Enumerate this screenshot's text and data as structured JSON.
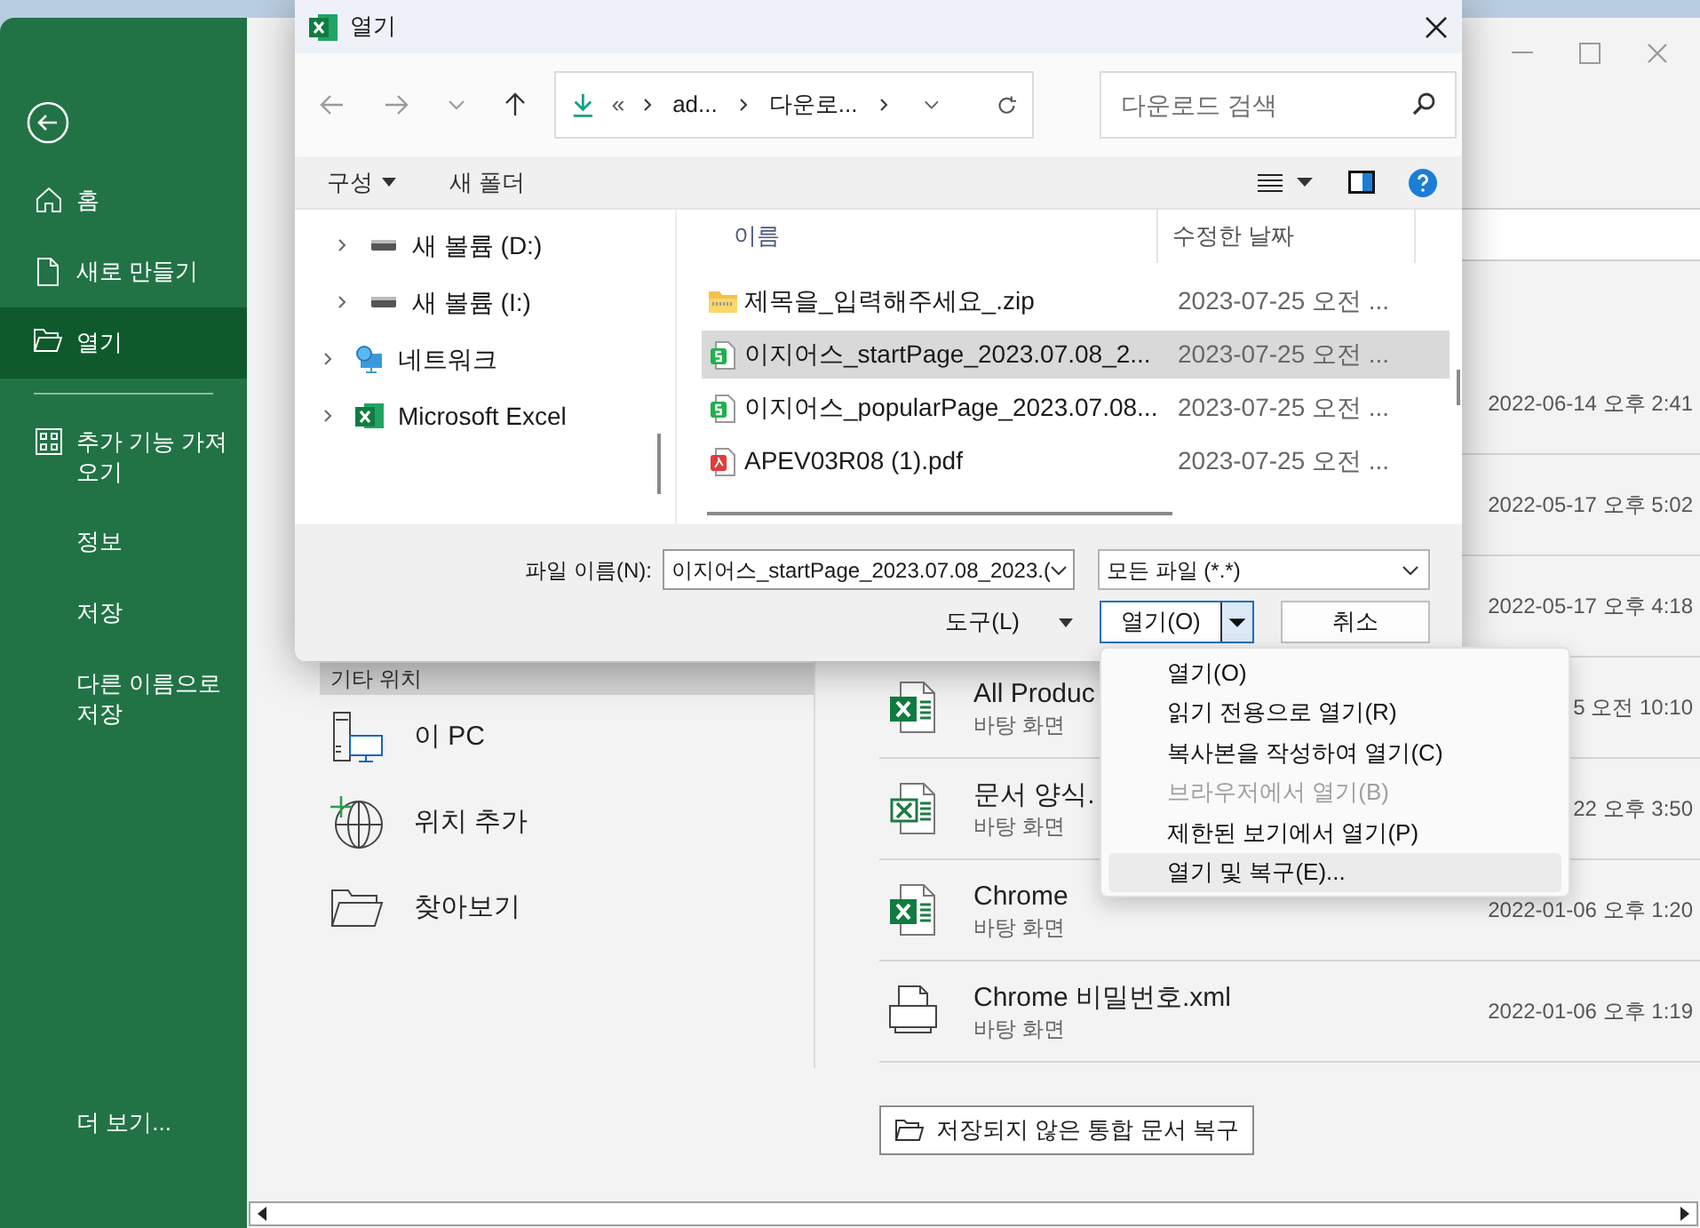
{
  "excel": {
    "sidebar": {
      "items": [
        {
          "kind": "home",
          "label": "홈",
          "selected": false
        },
        {
          "kind": "new",
          "label": "새로 만들기",
          "selected": false
        },
        {
          "kind": "open",
          "label": "열기",
          "selected": true
        },
        {
          "kind": "divider"
        },
        {
          "kind": "addins",
          "label": "추가 기능 가져오기",
          "selected": false
        },
        {
          "kind": "plain",
          "label": "정보",
          "selected": false
        },
        {
          "kind": "plain",
          "label": "저장",
          "selected": false
        },
        {
          "kind": "plain",
          "label": "다른 이름으로 저장",
          "selected": false
        }
      ],
      "footer": "더 보기..."
    },
    "other_locations": {
      "heading": "기타 위치",
      "items": [
        {
          "kind": "pc",
          "label": "이 PC"
        },
        {
          "kind": "add",
          "label": "위치 추가"
        },
        {
          "kind": "browse",
          "label": "찾아보기"
        }
      ]
    },
    "recent_files": [
      {
        "date": "2022-06-14 오후 2:41"
      },
      {
        "date": "2022-05-17 오후 5:02"
      },
      {
        "date": "2022-05-17 오후 4:18"
      },
      {
        "kind": "excel",
        "name": "All Produc",
        "location": "바탕 화면",
        "date": "5 오전 10:10"
      },
      {
        "kind": "excel-template",
        "name": "문서 양식.",
        "location": "바탕 화면",
        "date": "22 오후 3:50"
      },
      {
        "kind": "excel",
        "name": "Chrome",
        "location": "바탕 화면",
        "date": "2022-01-06 오후 1:20"
      },
      {
        "kind": "xml",
        "name": "Chrome 비밀번호.xml",
        "location": "바탕 화면",
        "date": "2022-01-06 오후 1:19"
      }
    ],
    "recover_button": "저장되지 않은 통합 문서 복구"
  },
  "dialog": {
    "title": "열기",
    "breadcrumb": [
      "«",
      "ad...",
      "다운로..."
    ],
    "search": {
      "placeholder": "다운로드 검색"
    },
    "toolbar": [
      "구성",
      "새 폴더"
    ],
    "tree": [
      {
        "kind": "drive",
        "label": "새 볼륨 (D:)",
        "expanded": false
      },
      {
        "kind": "drive",
        "label": "새 볼륨 (I:)",
        "expanded": false
      },
      {
        "kind": "network",
        "label": "네트워크",
        "expanded": false
      },
      {
        "kind": "excel",
        "label": "Microsoft Excel",
        "expanded": false
      }
    ],
    "columns": [
      "이름",
      "수정한 날짜"
    ],
    "files": [
      {
        "kind": "zip",
        "name": "제목을_입력해주세요_.zip",
        "date": "2023-07-25 오전 ...",
        "selected": false
      },
      {
        "kind": "sheet",
        "name": "이지어스_startPage_2023.07.08_2...",
        "date": "2023-07-25 오전 ...",
        "selected": true
      },
      {
        "kind": "sheet",
        "name": "이지어스_popularPage_2023.07.08...",
        "date": "2023-07-25 오전 ...",
        "selected": false
      },
      {
        "kind": "pdf",
        "name": "APEV03R08 (1).pdf",
        "date": "2023-07-25 오전 ...",
        "selected": false
      }
    ],
    "filename_label": "파일 이름(N):",
    "filename": "이지어스_startPage_2023.07.08_2023.(",
    "filter": "모든 파일 (*.*)",
    "tools": "도구(L)",
    "open_button": "열기(O)",
    "cancel_button": "취소",
    "open_menu": [
      {
        "label": "열기(O)",
        "disabled": false,
        "selected": false
      },
      {
        "label": "읽기 전용으로 열기(R)",
        "disabled": false,
        "selected": false
      },
      {
        "label": "복사본을 작성하여 열기(C)",
        "disabled": false,
        "selected": false
      },
      {
        "label": "브라우저에서 열기(B)",
        "disabled": true,
        "selected": false
      },
      {
        "label": "제한된 보기에서 열기(P)",
        "disabled": false,
        "selected": false
      },
      {
        "label": "열기 및 복구(E)...",
        "disabled": false,
        "selected": true
      }
    ]
  }
}
